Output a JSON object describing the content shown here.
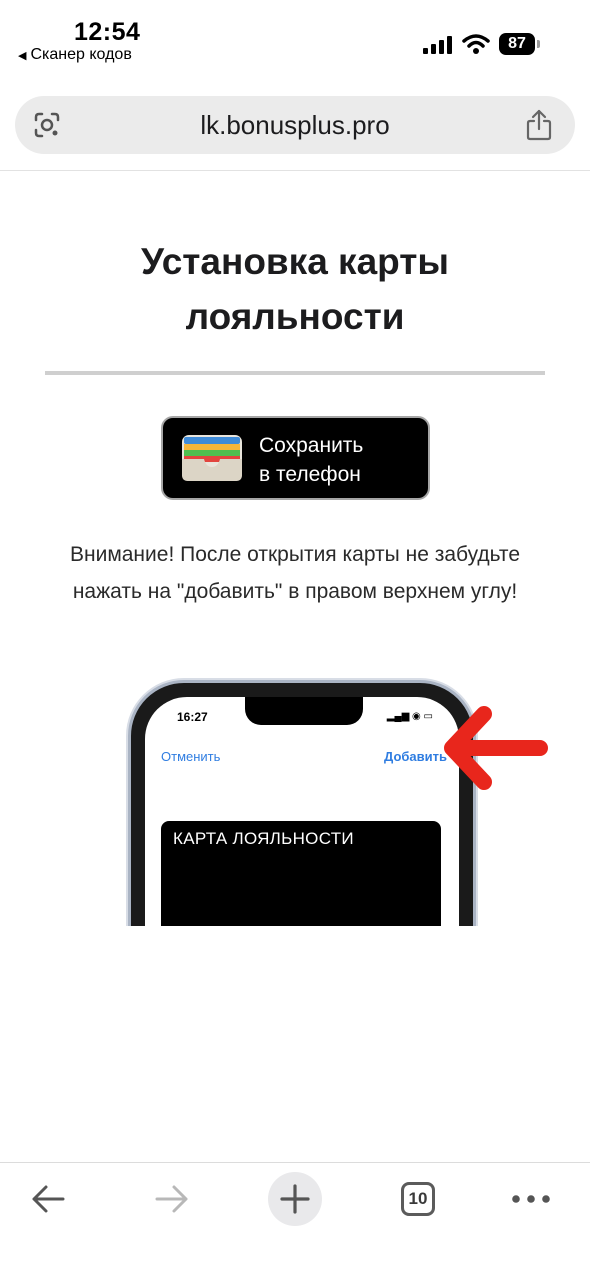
{
  "status_bar": {
    "time": "12:54",
    "back_app_label": "Сканер кодов",
    "battery_level": "87"
  },
  "browser": {
    "url": "lk.bonusplus.pro",
    "tab_count": "10"
  },
  "page": {
    "title": "Установка карты лояльности",
    "wallet_button": {
      "line1": "Сохранить",
      "line2": "в телефон"
    },
    "notice": "Внимание! После открытия карты не забудьте нажать на \"добавить\" в правом верхнем углу!"
  },
  "illustration": {
    "phone_time": "16:27",
    "cancel_label": "Отменить",
    "add_label": "Добавить",
    "card_title": "КАРТА ЛОЯЛЬНОСТИ"
  },
  "colors": {
    "link_blue": "#2f7de1",
    "arrow_red": "#e8261c"
  }
}
